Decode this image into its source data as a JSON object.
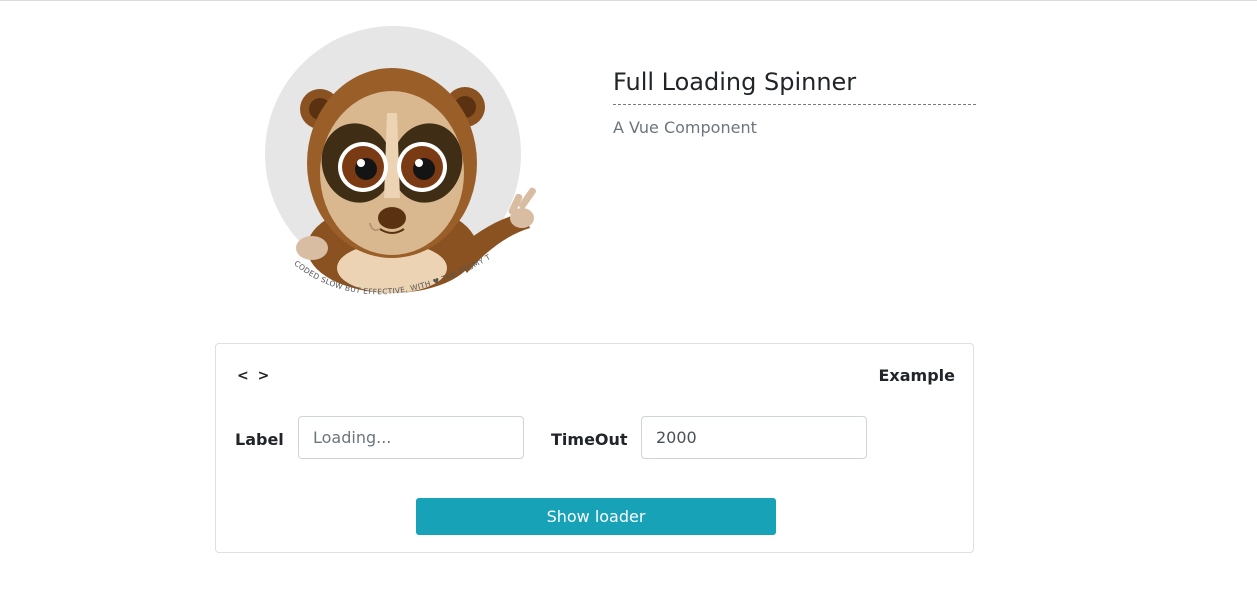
{
  "logo": {
    "name": "pygmy-loris-mascot",
    "tagline": "CODED SLOW BUT EFFECTIVE, WITH ♥ THE PYGMY TEAM"
  },
  "header": {
    "title": "Full Loading Spinner",
    "subtitle": "A Vue Component"
  },
  "card": {
    "code_toggle": "< >",
    "example_label": "Example",
    "label_field": {
      "label": "Label",
      "value": "",
      "placeholder": "Loading..."
    },
    "timeout_field": {
      "label": "TimeOut",
      "value": "2000",
      "placeholder": ""
    },
    "button_label": "Show loader"
  },
  "colors": {
    "button": "#17a2b8",
    "subtitle": "#6c757d",
    "logo_circle": "#e6e6e6"
  }
}
